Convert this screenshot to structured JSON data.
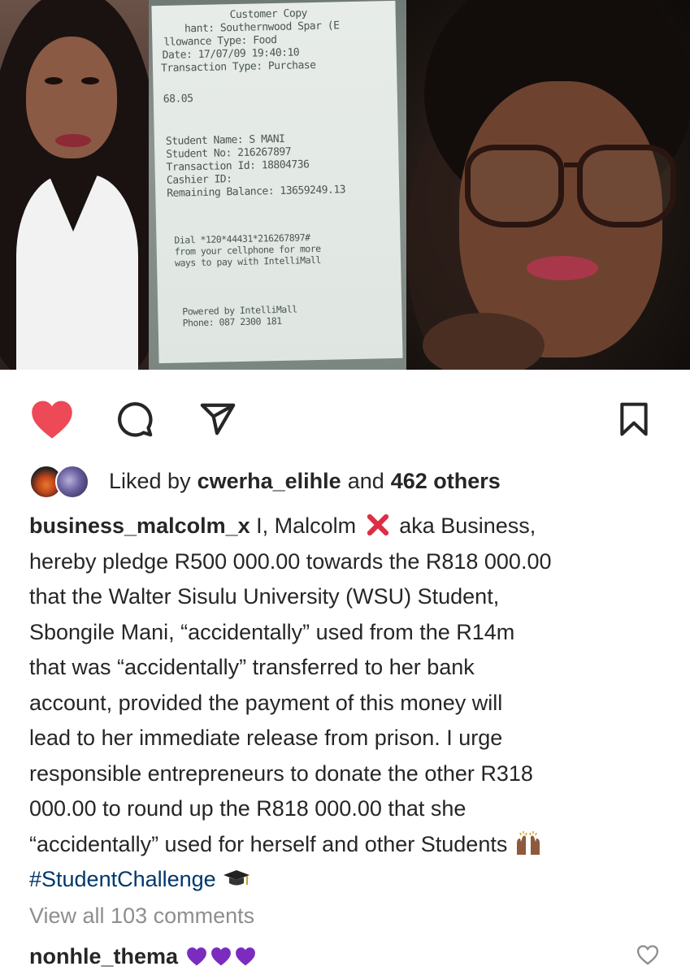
{
  "receipt": {
    "lines": [
      "Customer Copy",
      "hant: Southernwood Spar (E",
      "llowance Type: Food",
      "Date: 17/07/09 19:40:10",
      "Transaction Type: Purchase",
      "68.05",
      "Student Name: S MANI",
      "Student No: 216267897",
      "Transaction Id: 18804736",
      "Cashier ID:",
      "Remaining Balance: 13659249.13",
      "Dial *120*44431*216267897#",
      "from your cellphone for more",
      "ways to pay with IntelliMall",
      "Powered by IntelliMall",
      "Phone: 087 2300 181"
    ]
  },
  "actions": {
    "like_icon": "heart-icon",
    "like_color": "#ed4956",
    "comment_icon": "comment-icon",
    "share_icon": "share-icon",
    "save_icon": "bookmark-icon"
  },
  "likes": {
    "prefix": "Liked by",
    "user": "cwerha_elihle",
    "conj": "and",
    "others": "462 others"
  },
  "caption": {
    "username": "business_malcolm_x",
    "line1_a": "I, Malcolm",
    "line1_b": "aka Business,",
    "lines": [
      "hereby pledge R500 000.00 towards the R818 000.00",
      "that the Walter Sisulu University (WSU) Student,",
      "Sbongile Mani, “accidentally” used from the R14m",
      "that was “accidentally” transferred to her bank",
      "account, provided the payment of this money will",
      "lead to her immediate release from prison. I urge",
      "responsible entrepreneurs to donate the other R318",
      "000.00 to round up the R818 000.00 that she",
      "“accidentally” used for herself and other Students"
    ],
    "hashtag": "#StudentChallenge"
  },
  "comments": {
    "view_all": "View all 103 comments",
    "first_user": "nonhle_thema",
    "heart_color": "#7b2cbf"
  }
}
